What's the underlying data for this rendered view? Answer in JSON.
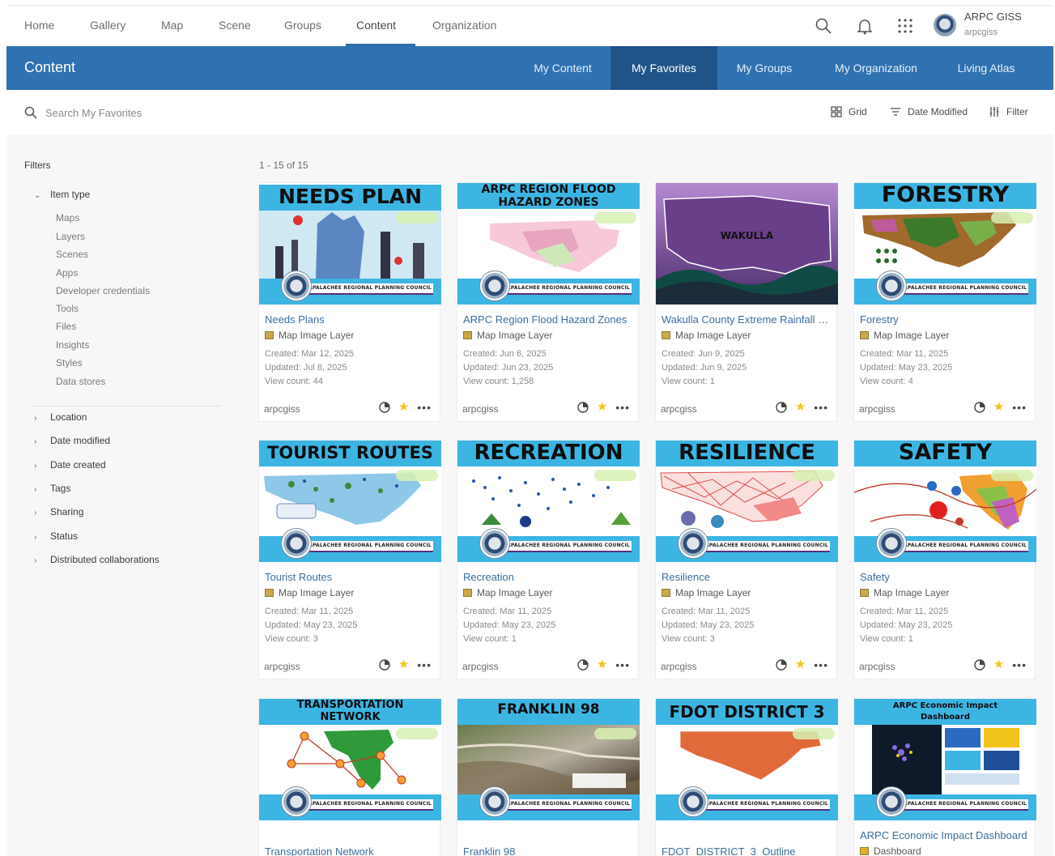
{
  "top_nav": {
    "links": [
      "Home",
      "Gallery",
      "Map",
      "Scene",
      "Groups",
      "Content",
      "Organization"
    ],
    "active": "Content",
    "user": {
      "name": "ARPC GISS",
      "username": "arpcgiss"
    }
  },
  "header": {
    "title": "Content",
    "tabs": [
      "My Content",
      "My Favorites",
      "My Groups",
      "My Organization",
      "Living Atlas"
    ],
    "active_tab": "My Favorites"
  },
  "search": {
    "placeholder": "Search My Favorites",
    "value": ""
  },
  "controls": {
    "view": "Grid",
    "sort": "Date Modified",
    "filter": "Filter"
  },
  "filters": {
    "title": "Filters",
    "item_type": {
      "label": "Item type",
      "items": [
        "Maps",
        "Layers",
        "Scenes",
        "Apps",
        "Developer credentials",
        "Tools",
        "Files",
        "Insights",
        "Styles",
        "Data stores"
      ]
    },
    "collapsed": [
      "Location",
      "Date modified",
      "Date created",
      "Tags",
      "Sharing",
      "Status",
      "Distributed collaborations"
    ]
  },
  "result_count": "1 - 15 of 15",
  "thumb_footer_text": "APALACHEE REGIONAL PLANNING COUNCIL",
  "cards": [
    {
      "thumb_title": "NEEDS PLAN",
      "title": "Needs Plans",
      "type": "Map Image Layer",
      "created": "Created: Mar 12, 2025",
      "updated": "Updated: Jul 8, 2025",
      "views": "View count: 44",
      "owner": "arpcgiss"
    },
    {
      "thumb_title": "ARPC REGION FLOOD HAZARD ZONES",
      "title": "ARPC Region Flood Hazard Zones",
      "type": "Map Image Layer",
      "created": "Created: Jun 6, 2025",
      "updated": "Updated: Jun 23, 2025",
      "views": "View count: 1,258",
      "owner": "arpcgiss"
    },
    {
      "thumb_title": "WAKULLA",
      "title": "Wakulla County Extreme Rainfall Event",
      "type": "Map Image Layer",
      "created": "Created: Jun 9, 2025",
      "updated": "Updated: Jun 9, 2025",
      "views": "View count: 1",
      "owner": "arpcgiss"
    },
    {
      "thumb_title": "FORESTRY",
      "title": "Forestry",
      "type": "Map Image Layer",
      "created": "Created: Mar 11, 2025",
      "updated": "Updated: May 23, 2025",
      "views": "View count: 4",
      "owner": "arpcgiss"
    },
    {
      "thumb_title": "TOURIST ROUTES",
      "title": "Tourist Routes",
      "type": "Map Image Layer",
      "created": "Created: Mar 11, 2025",
      "updated": "Updated: May 23, 2025",
      "views": "View count: 3",
      "owner": "arpcgiss"
    },
    {
      "thumb_title": "RECREATION",
      "title": "Recreation",
      "type": "Map Image Layer",
      "created": "Created: Mar 11, 2025",
      "updated": "Updated: May 23, 2025",
      "views": "View count: 1",
      "owner": "arpcgiss"
    },
    {
      "thumb_title": "RESILIENCE",
      "title": "Resilience",
      "type": "Map Image Layer",
      "created": "Created: Mar 11, 2025",
      "updated": "Updated: May 23, 2025",
      "views": "View count: 3",
      "owner": "arpcgiss"
    },
    {
      "thumb_title": "SAFETY",
      "title": "Safety",
      "type": "Map Image Layer",
      "created": "Created: Mar 11, 2025",
      "updated": "Updated: May 23, 2025",
      "views": "View count: 1",
      "owner": "arpcgiss"
    },
    {
      "thumb_title": "TRANSPORTATION NETWORK",
      "title": "Transportation Network"
    },
    {
      "thumb_title": "FRANKLIN 98",
      "title": "Franklin 98"
    },
    {
      "thumb_title": "FDOT DISTRICT 3",
      "title": "FDOT_DISTRICT_3_Outline"
    },
    {
      "thumb_title": "ARPC Economic Impact Dashboard",
      "title": "ARPC Economic Impact Dashboard",
      "type": "Dashboard"
    }
  ],
  "icons": {
    "search": "search-icon",
    "bell": "bell-icon",
    "apps": "app-launcher-icon",
    "grid": "grid-icon",
    "sort": "sort-icon",
    "filter": "filter-icon",
    "share": "sharing-icon",
    "favorite": "star-icon",
    "more": "more-icon"
  },
  "colors": {
    "header_blue": "#2f72b1",
    "active_tab": "#1f5488",
    "thumb_banner": "#3db5e3",
    "link": "#3a6ea0",
    "star": "#f2c318"
  }
}
